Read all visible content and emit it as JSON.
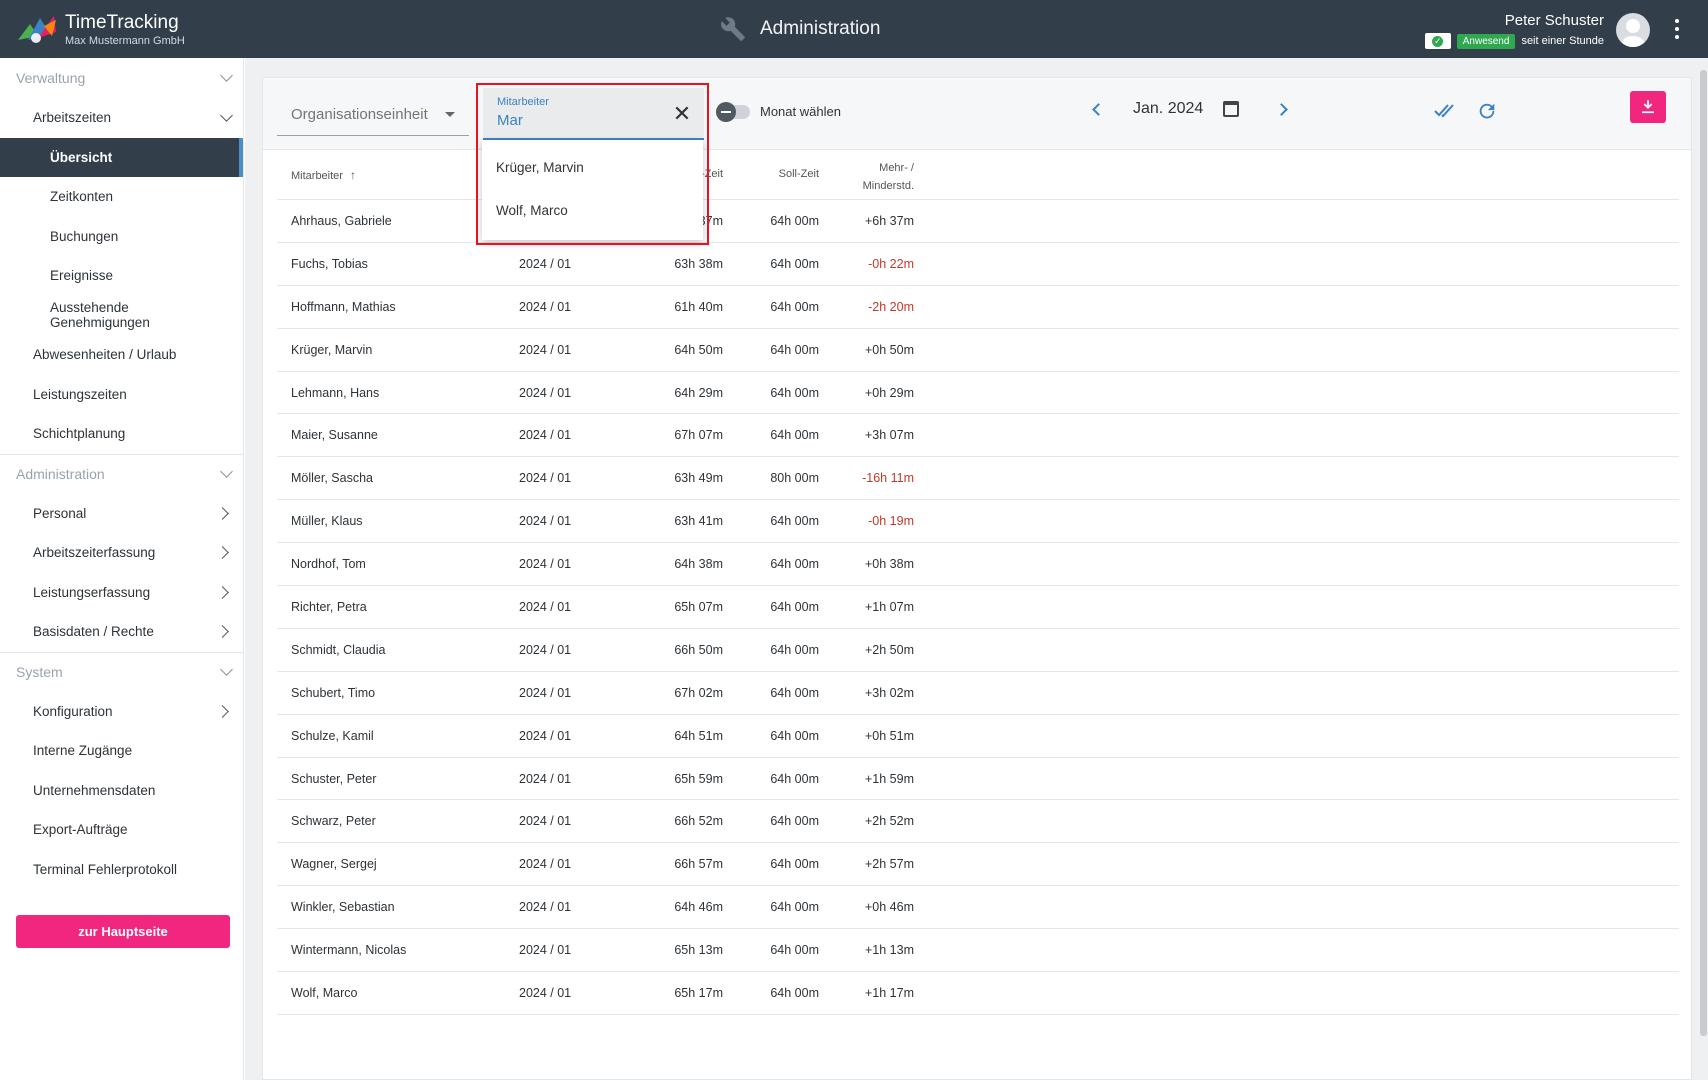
{
  "header": {
    "app_name": "TimeTracking",
    "company": "Max Mustermann GmbH",
    "section_title": "Administration",
    "user_name": "Peter Schuster",
    "status_label": "Anwesend",
    "status_since": "seit einer Stunde",
    "icons": [
      "logo",
      "wrench-icon",
      "check-icon",
      "avatar",
      "more-vert-icon"
    ]
  },
  "sidebar": {
    "verwaltung": {
      "title": "Verwaltung",
      "group_label": "Arbeitszeiten",
      "sub_items": [
        "Übersicht",
        "Zeitkonten",
        "Buchungen",
        "Ereignisse",
        "Ausstehende Genehmigungen"
      ],
      "items": [
        "Abwesenheiten / Urlaub",
        "Leistungszeiten",
        "Schichtplanung"
      ]
    },
    "administration": {
      "title": "Administration",
      "items": [
        "Personal",
        "Arbeitszeiterfassung",
        "Leistungserfassung",
        "Basisdaten / Rechte"
      ]
    },
    "system": {
      "title": "System",
      "items": [
        "Konfiguration",
        "Interne Zugänge",
        "Unternehmensdaten",
        "Export-Aufträge",
        "Terminal Fehlerprotokoll"
      ]
    },
    "home_button": "zur Hauptseite",
    "active_item": "Übersicht"
  },
  "toolbar": {
    "org_unit_label": "Organisationseinheit",
    "employee_field_label": "Mitarbeiter",
    "employee_field_value": "Mar",
    "month_toggle_label": "Monat wählen",
    "month": "Jan. 2024"
  },
  "dropdown": {
    "options": [
      "Krüger, Marvin",
      "Wolf, Marco"
    ]
  },
  "table": {
    "columns": {
      "employee": "Mitarbeiter",
      "ist_partial": "-Zeit",
      "soll": "Soll-Zeit",
      "diff_line1": "Mehr- /",
      "diff_line2": "Minderstd."
    },
    "first_row_ist_partial": "37m",
    "rows": [
      {
        "name": "Ahrhaus, Gabriele",
        "period": "2024 / 01",
        "ist": "64h 37m",
        "soll": "64h 00m",
        "diff": "+6h 37m",
        "neg": false
      },
      {
        "name": "Fuchs, Tobias",
        "period": "2024 / 01",
        "ist": "63h 38m",
        "soll": "64h 00m",
        "diff": "-0h 22m",
        "neg": true
      },
      {
        "name": "Hoffmann, Mathias",
        "period": "2024 / 01",
        "ist": "61h 40m",
        "soll": "64h 00m",
        "diff": "-2h 20m",
        "neg": true
      },
      {
        "name": "Krüger, Marvin",
        "period": "2024 / 01",
        "ist": "64h 50m",
        "soll": "64h 00m",
        "diff": "+0h 50m",
        "neg": false
      },
      {
        "name": "Lehmann, Hans",
        "period": "2024 / 01",
        "ist": "64h 29m",
        "soll": "64h 00m",
        "diff": "+0h 29m",
        "neg": false
      },
      {
        "name": "Maier, Susanne",
        "period": "2024 / 01",
        "ist": "67h 07m",
        "soll": "64h 00m",
        "diff": "+3h 07m",
        "neg": false
      },
      {
        "name": "Möller, Sascha",
        "period": "2024 / 01",
        "ist": "63h 49m",
        "soll": "80h 00m",
        "diff": "-16h 11m",
        "neg": true
      },
      {
        "name": "Müller, Klaus",
        "period": "2024 / 01",
        "ist": "63h 41m",
        "soll": "64h 00m",
        "diff": "-0h 19m",
        "neg": true
      },
      {
        "name": "Nordhof, Tom",
        "period": "2024 / 01",
        "ist": "64h 38m",
        "soll": "64h 00m",
        "diff": "+0h 38m",
        "neg": false
      },
      {
        "name": "Richter, Petra",
        "period": "2024 / 01",
        "ist": "65h 07m",
        "soll": "64h 00m",
        "diff": "+1h 07m",
        "neg": false
      },
      {
        "name": "Schmidt, Claudia",
        "period": "2024 / 01",
        "ist": "66h 50m",
        "soll": "64h 00m",
        "diff": "+2h 50m",
        "neg": false
      },
      {
        "name": "Schubert, Timo",
        "period": "2024 / 01",
        "ist": "67h 02m",
        "soll": "64h 00m",
        "diff": "+3h 02m",
        "neg": false
      },
      {
        "name": "Schulze, Kamil",
        "period": "2024 / 01",
        "ist": "64h 51m",
        "soll": "64h 00m",
        "diff": "+0h 51m",
        "neg": false
      },
      {
        "name": "Schuster, Peter",
        "period": "2024 / 01",
        "ist": "65h 59m",
        "soll": "64h 00m",
        "diff": "+1h 59m",
        "neg": false
      },
      {
        "name": "Schwarz, Peter",
        "period": "2024 / 01",
        "ist": "66h 52m",
        "soll": "64h 00m",
        "diff": "+2h 52m",
        "neg": false
      },
      {
        "name": "Wagner, Sergej",
        "period": "2024 / 01",
        "ist": "66h 57m",
        "soll": "64h 00m",
        "diff": "+2h 57m",
        "neg": false
      },
      {
        "name": "Winkler, Sebastian",
        "period": "2024 / 01",
        "ist": "64h 46m",
        "soll": "64h 00m",
        "diff": "+0h 46m",
        "neg": false
      },
      {
        "name": "Wintermann, Nicolas",
        "period": "2024 / 01",
        "ist": "65h 13m",
        "soll": "64h 00m",
        "diff": "+1h 13m",
        "neg": false
      },
      {
        "name": "Wolf, Marco",
        "period": "2024 / 01",
        "ist": "65h 17m",
        "soll": "64h 00m",
        "diff": "+1h 17m",
        "neg": false
      }
    ]
  },
  "colors": {
    "header_bg": "#323f4b",
    "accent_pink": "#f0267f",
    "accent_blue": "#3b82c4",
    "negative": "#c0392b",
    "status_green": "#2fa84f",
    "highlight_red": "#e8131f"
  }
}
